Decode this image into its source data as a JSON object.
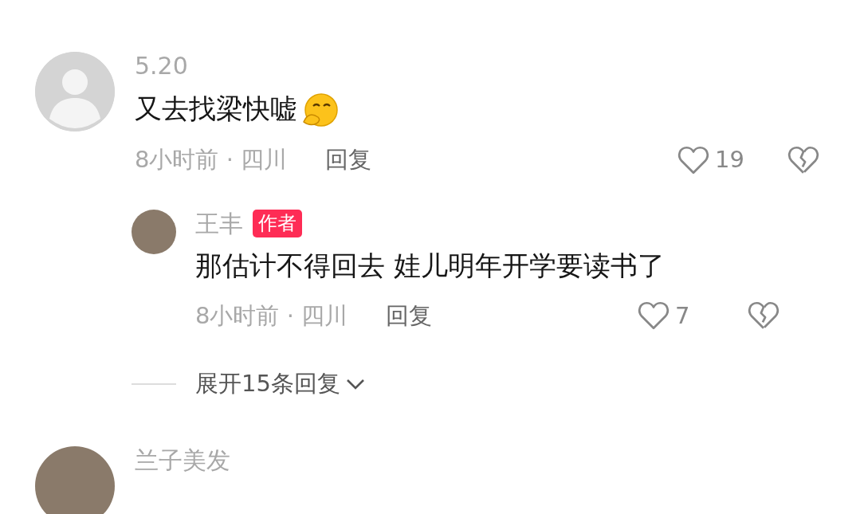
{
  "comments": [
    {
      "avatar_photo": false,
      "name": "5.20",
      "text": "又去找梁快嘘",
      "emoji_suffix": true,
      "time_location": "8小时前 · 四川",
      "reply_label": "回复",
      "likes": "19",
      "replies": [
        {
          "avatar_photo": true,
          "name": "王丰",
          "badge": "作者",
          "text": "那估计不得回去 娃儿明年开学要读书了",
          "time_location": "8小时前 · 四川",
          "reply_label": "回复",
          "likes": "7"
        }
      ],
      "expand_replies": "展开15条回复"
    },
    {
      "avatar_photo": true,
      "name": "兰子美发"
    }
  ]
}
